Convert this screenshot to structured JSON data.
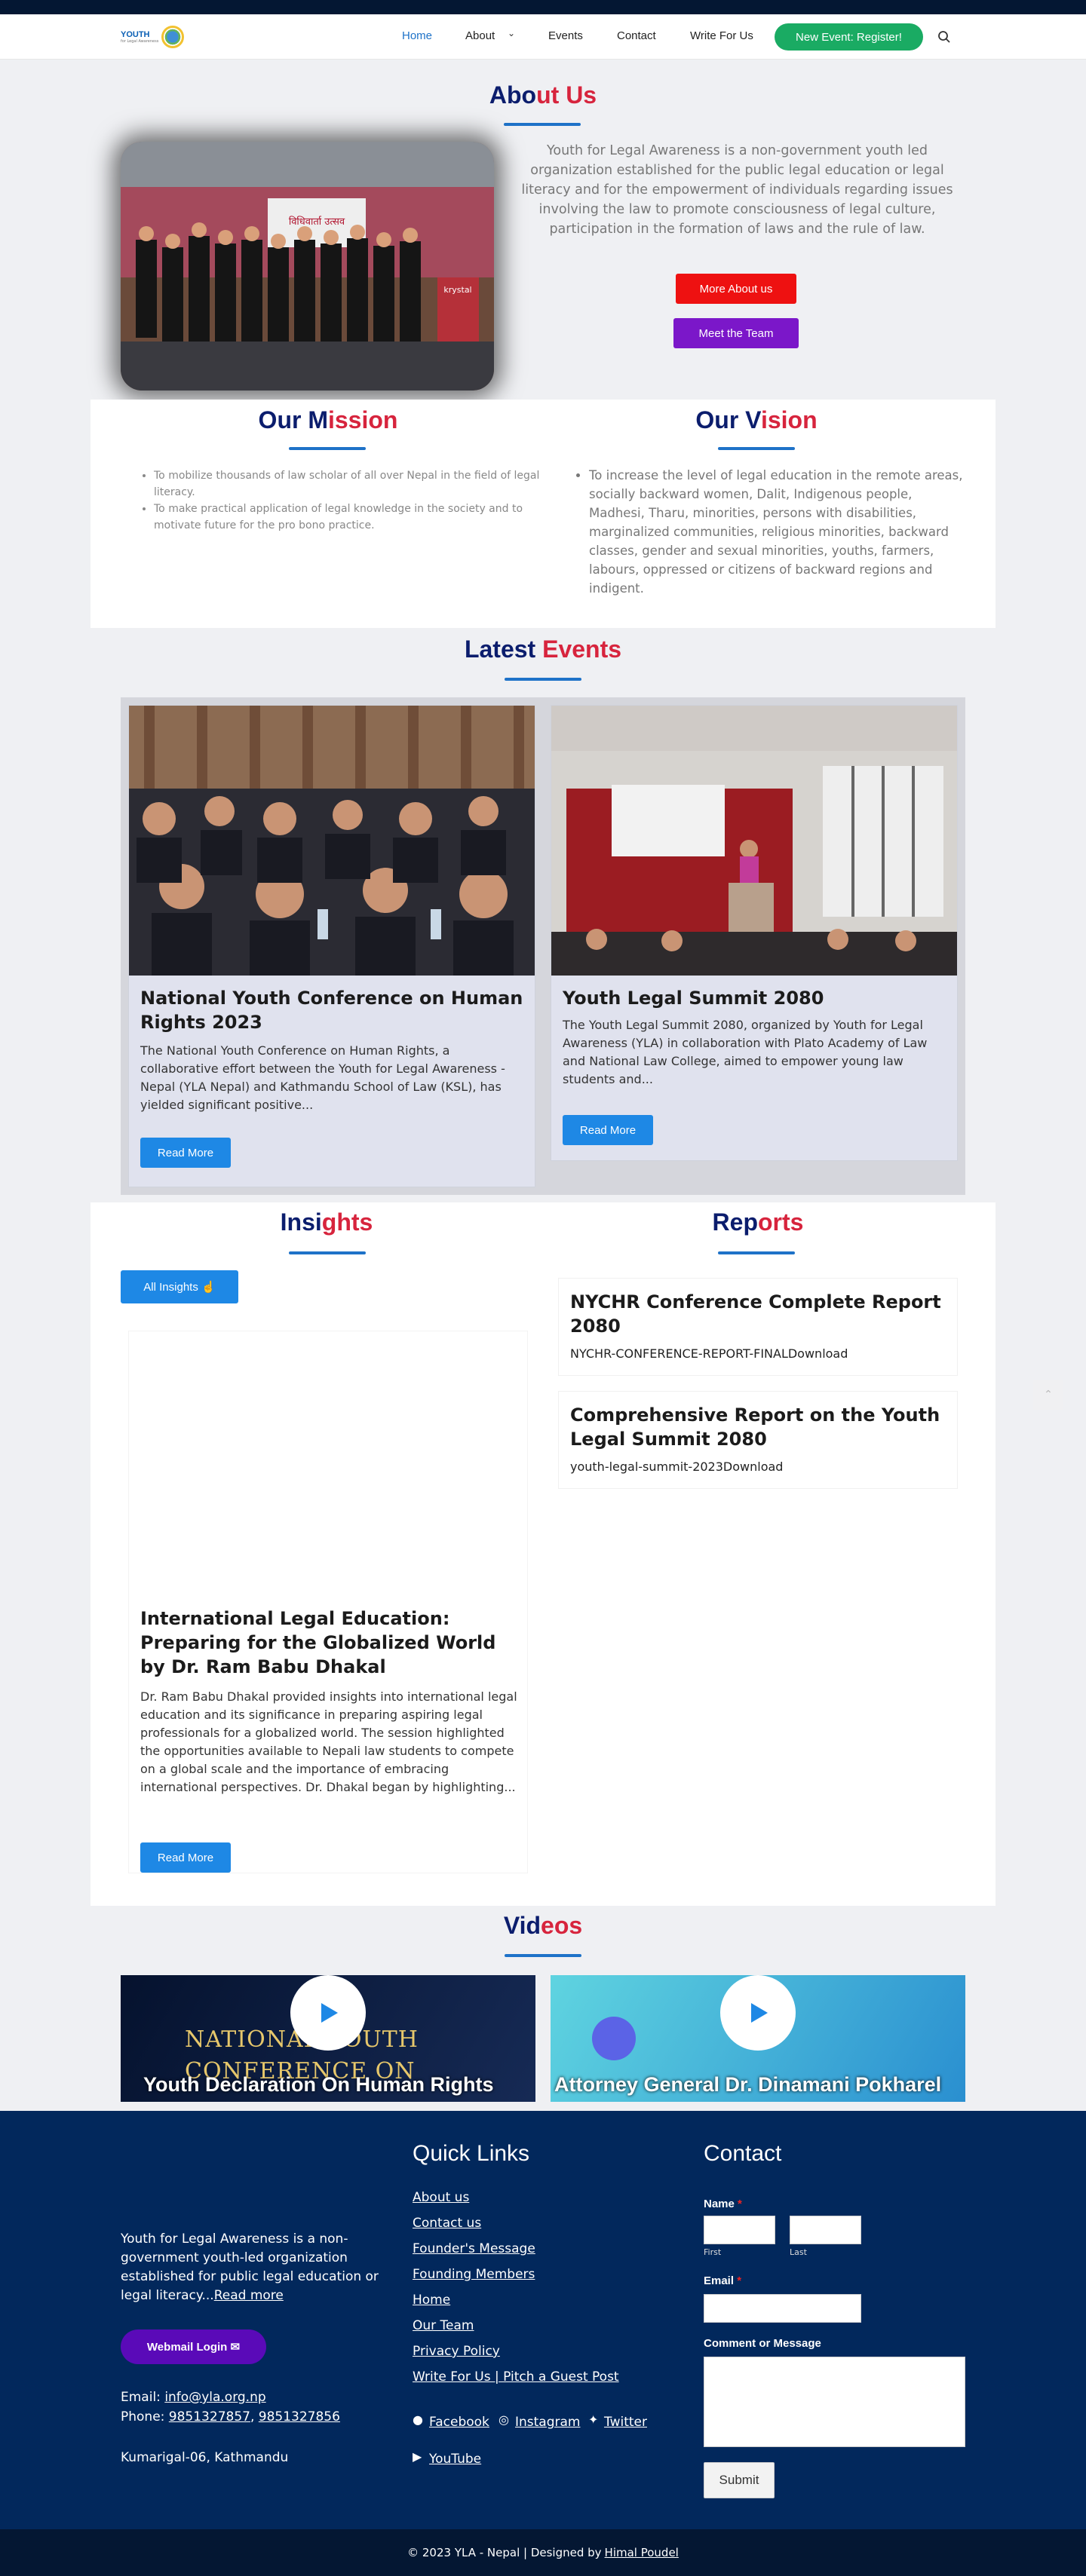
{
  "brand": {
    "logo_text": "YOUTH",
    "logo_subtext": "for Legal Awareness"
  },
  "nav": {
    "home": "Home",
    "about": "About",
    "events": "Events",
    "contact": "Contact",
    "write": "Write For Us",
    "register": "New Event: Register!"
  },
  "about": {
    "title_a": "Abo",
    "title_b": "ut Us",
    "text": "Youth for Legal Awareness is a non-government youth led organization established for the public legal education or legal literacy and for the empowerment of individuals regarding issues involving the law to promote consciousness of legal culture, participation in the formation of laws and the rule of law.",
    "more_btn": "More About us",
    "team_btn": "Meet the Team",
    "banner_text": "विधिवार्ता उत्सव",
    "stand_text": "krystal"
  },
  "mission": {
    "title_a": "Our M",
    "title_b": "ission",
    "items": [
      "To mobilize thousands of law scholar of all over Nepal in the field of legal literacy.",
      "To make practical application of legal knowledge in the society and to motivate future for the pro bono practice."
    ]
  },
  "vision": {
    "title_a": "Our V",
    "title_b": "ision",
    "items": [
      "To increase the level of legal education in the remote areas, socially backward women, Dalit, Indigenous people, Madhesi, Tharu, minorities, persons with disabilities, marginalized communities, religious minorities, backward classes, gender and sexual minorities, youths, farmers, labours, oppressed or citizens of backward regions and indigent."
    ]
  },
  "events": {
    "title_a": "Latest ",
    "title_b": "Events",
    "cards": [
      {
        "title": "National Youth Conference on Human Rights 2023",
        "excerpt": "The National Youth Conference on Human Rights, a collaborative effort between the Youth for Legal Awareness - Nepal (YLA Nepal) and Kathmandu School of Law (KSL), has yielded significant positive...",
        "btn": "Read More"
      },
      {
        "title": "Youth Legal Summit 2080",
        "excerpt": "The Youth Legal Summit 2080, organized by Youth for Legal Awareness (YLA) in collaboration with Plato Academy of Law and National Law College, aimed to empower young law students and...",
        "btn": "Read More"
      }
    ]
  },
  "insights": {
    "title_a": "Insi",
    "title_b": "ghts",
    "all_btn": "All Insights",
    "card": {
      "title": "International Legal Education: Preparing for the Globalized World by Dr. Ram Babu Dhakal",
      "excerpt": "Dr. Ram Babu Dhakal provided insights into international legal education and its significance in preparing aspiring legal professionals for a globalized world. The session highlighted the opportunities available to Nepali law students to compete on a global scale and the importance of embracing international perspectives. Dr. Dhakal began by highlighting...",
      "btn": "Read More"
    }
  },
  "reports": {
    "title_a": "Rep",
    "title_b": "orts",
    "items": [
      {
        "title": "NYCHR Conference Complete Report 2080",
        "file": "NYCHR-CONFERENCE-REPORT-FINALDownload"
      },
      {
        "title": "Comprehensive Report on the Youth Legal Summit 2080",
        "file": "youth-legal-summit-2023Download"
      }
    ]
  },
  "videos": {
    "title_a": "Vid",
    "title_b": "eos",
    "items": [
      {
        "title": "Youth Declaration On Human Rights",
        "overlay_l1": "NATIONAL YOUTH",
        "overlay_l2": "CONFERENCE ON"
      },
      {
        "title": "Attorney General Dr. Dinamani Pokharel"
      }
    ]
  },
  "footer": {
    "about": "Youth for Legal Awareness is a non-government youth-led organization established for public legal education or legal literacy...",
    "read_more": "Read more",
    "webmail": "Webmail Login",
    "email_label": "Email:",
    "email": "info@yla.org.np",
    "phone_label": "Phone:",
    "phone1": "9851327857",
    "phone2": "9851327856",
    "address": "Kumarigal-06, Kathmandu",
    "quick_title": "Quick Links",
    "links": [
      "About us",
      "Contact us",
      "Founder's Message",
      "Founding Members",
      "Home",
      "Our Team",
      "Privacy Policy",
      "Write For Us | Pitch a Guest Post"
    ],
    "social": {
      "facebook": "Facebook",
      "instagram": "Instagram",
      "twitter": "Twitter",
      "youtube": "YouTube"
    },
    "contact_title": "Contact",
    "name_label": "Name",
    "first": "First",
    "last": "Last",
    "email_field_label": "Email",
    "comment_label": "Comment or Message",
    "submit": "Submit",
    "copyright": "© 2023 YLA - Nepal | Designed by ",
    "designer": "Himal Poudel"
  },
  "colors": {
    "navy": "#0b1d6d",
    "red": "#d7243d",
    "accent": "#1e88e5",
    "green": "#1aab63",
    "footer": "#02285c"
  }
}
